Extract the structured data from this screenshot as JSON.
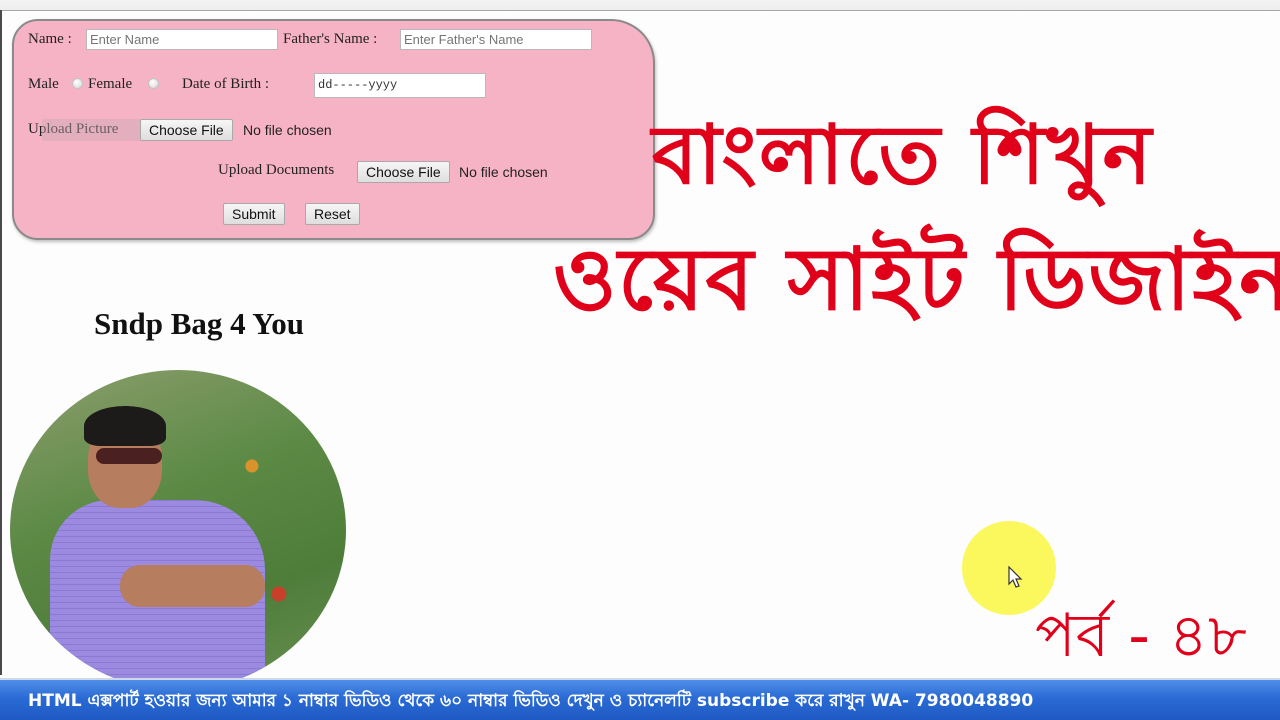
{
  "form": {
    "name_label": "Name :",
    "name_placeholder": "Enter Name",
    "father_label": "Father's Name :",
    "father_placeholder": "Enter Father's Name",
    "male_label": "Male",
    "female_label": "Female",
    "dob_label": "Date of Birth :",
    "dob_value": "dd-----yyyy",
    "upload_picture_label": "Upload Picture",
    "upload_documents_label": "Upload Documents",
    "choose_file_label": "Choose File",
    "no_file_text": "No file chosen",
    "submit_label": "Submit",
    "reset_label": "Reset",
    "background_color": "#f7b3c6"
  },
  "site_name": "Sndp Bag 4 You",
  "overlay": {
    "title_line1": "বাংলাতে শিখুন",
    "title_line2": "ওয়েব সাইট ডিজাইন",
    "episode": "পর্ব  - ৪৮",
    "accent_color": "#e0001a"
  },
  "ticker": {
    "text": "HTML এক্সপার্ট হওয়ার জন্য আমার ১ নাম্বার ভিডিও থেকে ৬০ নাম্বার ভিডিও দেখুন ও চ্যানেলটি subscribe করে রাখুন  WA- 7980048890"
  },
  "icons": {
    "cursor": "mouse-pointer-icon",
    "photo": "profile-photo"
  }
}
